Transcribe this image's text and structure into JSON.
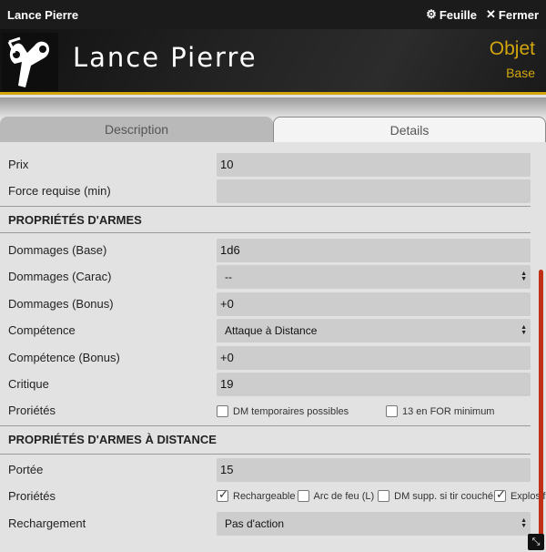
{
  "window": {
    "title": "Lance Pierre"
  },
  "toolbar": {
    "sheet_label": "Feuille",
    "close_label": "Fermer"
  },
  "header": {
    "name": "Lance Pierre",
    "type": "Objet",
    "subtype": "Base"
  },
  "tabs": {
    "description": "Description",
    "details": "Details",
    "active": "Details"
  },
  "fields": {
    "prix": {
      "label": "Prix",
      "value": "10"
    },
    "force": {
      "label": "Force requise (min)",
      "value": ""
    }
  },
  "weapon": {
    "section_title": "PROPRIÉTÉS D'ARMES",
    "dmg_base": {
      "label": "Dommages (Base)",
      "value": "1d6"
    },
    "dmg_carac": {
      "label": "Dommages (Carac)",
      "value": "--"
    },
    "dmg_bonus": {
      "label": "Dommages (Bonus)",
      "value": "+0"
    },
    "skill": {
      "label": "Compétence",
      "value": "Attaque à Distance"
    },
    "skill_bonus": {
      "label": "Compétence (Bonus)",
      "value": "+0"
    },
    "crit": {
      "label": "Critique",
      "value": "19"
    },
    "props": {
      "label": "Proriétés",
      "options": [
        {
          "label": "DM temporaires possibles",
          "checked": false
        },
        {
          "label": "13 en FOR minimum",
          "checked": false
        }
      ]
    }
  },
  "ranged": {
    "section_title": "PROPRIÉTÉS D'ARMES À DISTANCE",
    "range": {
      "label": "Portée",
      "value": "15"
    },
    "props": {
      "label": "Proriétés",
      "options": [
        {
          "label": "Rechargeable",
          "checked": true
        },
        {
          "label": "Arc de feu (L)",
          "checked": false
        },
        {
          "label": "DM supp. si tir couché",
          "checked": false
        },
        {
          "label": "Explosif",
          "checked": true
        }
      ]
    },
    "reload": {
      "label": "Rechargement",
      "value": "Pas d'action"
    }
  },
  "colors": {
    "accent": "#d2a60c",
    "scroll_thumb": "#c03017",
    "titlebar": "#1b1b1b"
  }
}
